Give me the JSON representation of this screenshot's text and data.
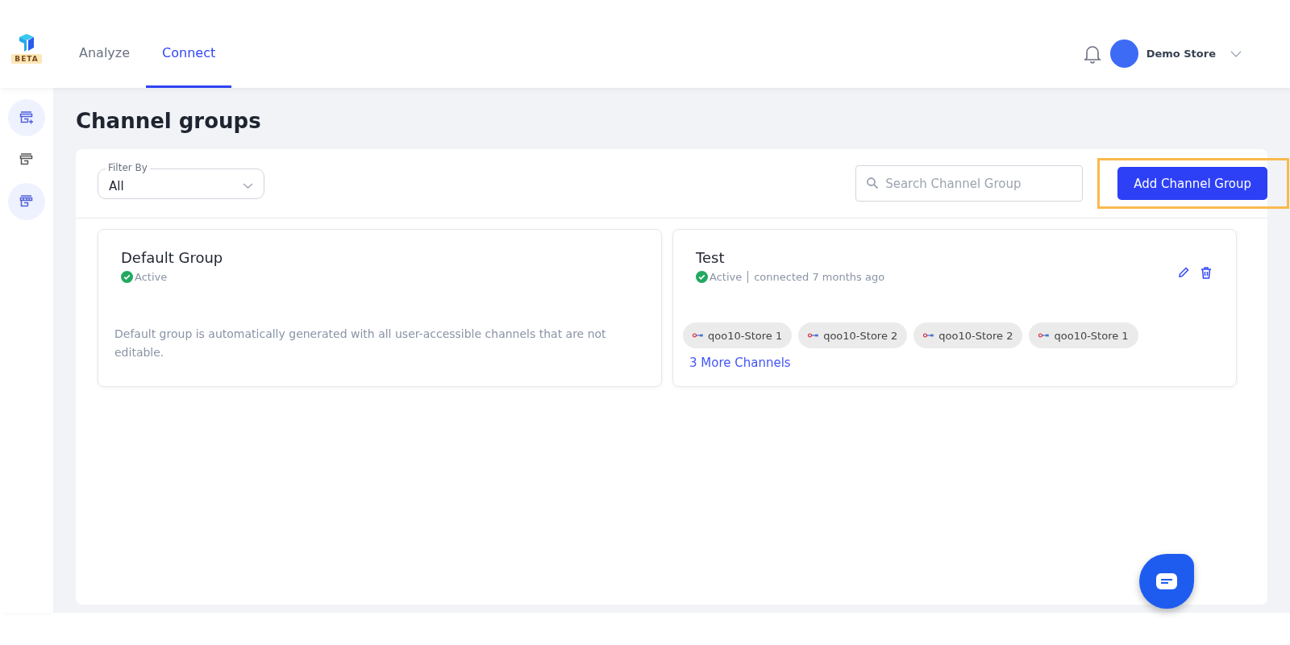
{
  "logo": {
    "badge": "BETA"
  },
  "nav_tabs": [
    {
      "label": "Analyze",
      "selected": false
    },
    {
      "label": "Connect",
      "selected": true
    }
  ],
  "user": {
    "name": "Demo Store"
  },
  "sidebar": {
    "items": [
      {
        "selected": true
      },
      {
        "selected": false
      },
      {
        "selected": true
      }
    ]
  },
  "page_title": "Channel groups",
  "filter": {
    "label": "Filter By",
    "value": "All"
  },
  "search": {
    "placeholder": "Search Channel Group"
  },
  "add_button": {
    "label": "Add Channel Group",
    "highlighted": true
  },
  "groups": [
    {
      "name": "Default Group",
      "status": "Active",
      "active": true,
      "description": "Default group is automatically generated with all user-accessible channels that are not editable.",
      "editable": false
    },
    {
      "name": "Test",
      "status": "Active",
      "active": true,
      "connected": "connected 7 months ago",
      "editable": true,
      "channels": [
        "qoo10-Store 1",
        "qoo10-Store 2",
        "qoo10-Store 2",
        "qoo10-Store 1"
      ],
      "more_link": "3 More Channels"
    }
  ]
}
